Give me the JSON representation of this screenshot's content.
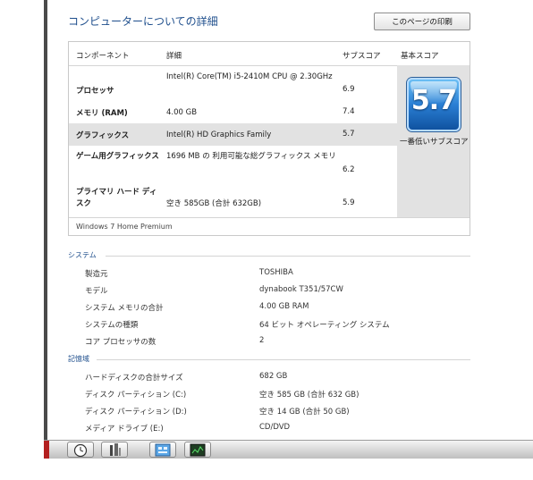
{
  "page": {
    "title": "コンピューターについての詳細",
    "print_button": "このページの印刷"
  },
  "score_table": {
    "headers": {
      "component": "コンポーネント",
      "detail": "詳細",
      "subscore": "サブスコア",
      "base": "基本スコア"
    },
    "rows": [
      {
        "component": "プロセッサ",
        "detail": "Intel(R) Core(TM) i5-2410M CPU @ 2.30GHz",
        "subscore": "6.9"
      },
      {
        "component": "メモリ (RAM)",
        "detail": "4.00 GB",
        "subscore": "7.4"
      },
      {
        "component": "グラフィックス",
        "detail": "Intel(R) HD Graphics Family",
        "subscore": "5.7"
      },
      {
        "component": "ゲーム用グラフィックス",
        "detail": "1696 MB の 利用可能な総グラフィックス メモリ",
        "subscore": "6.2"
      },
      {
        "component": "プライマリ ハード ディスク",
        "detail": "空き 585GB (合計 632GB)",
        "subscore": "5.9"
      }
    ],
    "base_score": "5.7",
    "base_score_label": "一番低いサブスコア",
    "edition": "Windows 7 Home Premium"
  },
  "system": {
    "heading": "システム",
    "items": [
      {
        "key": "製造元",
        "value": "TOSHIBA"
      },
      {
        "key": "モデル",
        "value": "dynabook T351/57CW"
      },
      {
        "key": "システム メモリの合計",
        "value": "4.00 GB RAM"
      },
      {
        "key": "システムの種類",
        "value": "64 ビット オペレーティング システム"
      },
      {
        "key": "コア プロセッサの数",
        "value": "2"
      }
    ]
  },
  "storage": {
    "heading": "記憶域",
    "items": [
      {
        "key": "ハードディスクの合計サイズ",
        "value": "682 GB"
      },
      {
        "key": "ディスク パーティション (C:)",
        "value": "空き 585 GB (合計 632 GB)"
      },
      {
        "key": "ディスク パーティション (D:)",
        "value": "空き 14 GB (合計 50 GB)"
      },
      {
        "key": "メディア ドライブ (E:)",
        "value": "CD/DVD"
      }
    ]
  },
  "colors": {
    "accent": "#1e4e8c",
    "highlight": "#e2e2e2",
    "badge": "#2a7fd4"
  },
  "taskbar": {
    "icons": [
      "clock-icon",
      "tools-icon",
      "performance-icon",
      "monitor-icon"
    ]
  }
}
